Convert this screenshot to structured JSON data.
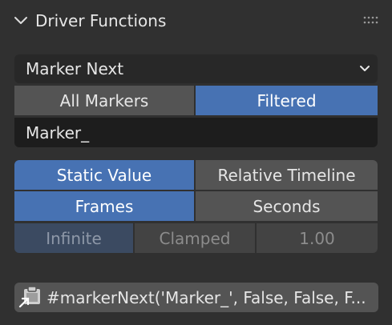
{
  "panel": {
    "title": "Driver Functions",
    "collapse_icon": "chevron-down-icon",
    "grip_icon": "drag-grip-icon"
  },
  "function_select": {
    "value": "Marker Next",
    "arrow_icon": "chevron-down-icon"
  },
  "marker_scope": {
    "options": [
      "All Markers",
      "Filtered"
    ],
    "selected": "Filtered"
  },
  "filter_input": {
    "value": "Marker_"
  },
  "value_mode": {
    "options": [
      "Static Value",
      "Relative Timeline"
    ],
    "selected": "Static Value"
  },
  "time_unit": {
    "options": [
      "Frames",
      "Seconds"
    ],
    "selected": "Frames"
  },
  "range_mode": {
    "options": [
      "Infinite",
      "Clamped"
    ],
    "selected": "Infinite",
    "value": "1.00",
    "enabled": false
  },
  "expression": {
    "icon": "paste-expression-icon",
    "value": "#markerNext('Marker_', False, False, F..."
  },
  "colors": {
    "background": "#303030",
    "button": "#545454",
    "accent": "#4772b3",
    "field": "#1d1d1d"
  }
}
